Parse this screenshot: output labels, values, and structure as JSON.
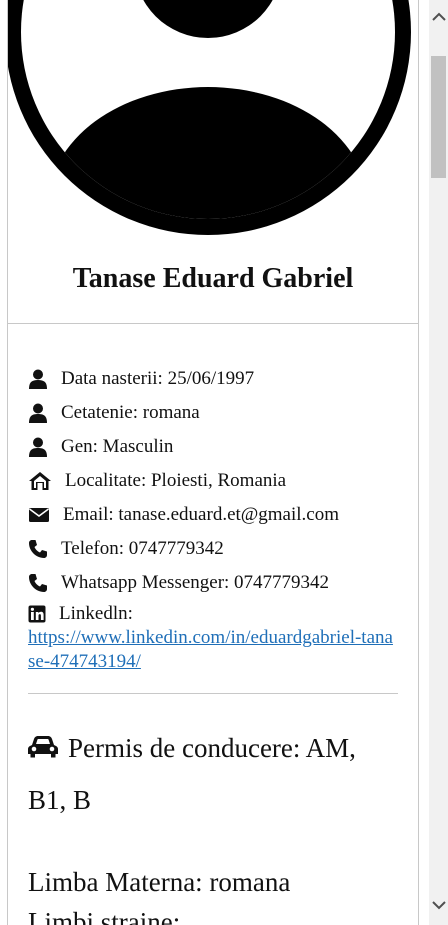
{
  "profile": {
    "name": "Tanase Eduard Gabriel"
  },
  "info": {
    "birth": "Data nasterii: 25/06/1997",
    "citizenship": "Cetatenie: romana",
    "gender": "Gen: Masculin",
    "location": "Localitate: Ploiesti, Romania",
    "email": "Email: tanase.eduard.et@gmail.com",
    "phone": "Telefon: 0747779342",
    "whatsapp": "Whatsapp Messenger: 0747779342",
    "linkedin_label": "Linkedln:",
    "linkedin_url": "https://www.linkedin.com/in/eduardgabriel-tanase-474743194/"
  },
  "details": {
    "permit": "Permis de conducere: AM, B1, B",
    "mother_tongue": "Limba Materna: romana",
    "foreign_languages": "Limbi straine:"
  },
  "icons": {
    "birth": "user-icon",
    "citizenship": "user-icon",
    "gender": "user-icon",
    "location": "home-icon",
    "email": "envelope-icon",
    "phone": "phone-icon",
    "whatsapp": "phone-icon",
    "linkedin": "linkedin-icon",
    "permit": "car-icon"
  },
  "colors": {
    "link": "#1f6fb8",
    "divider": "#c8c8c8",
    "icon": "#111111"
  }
}
